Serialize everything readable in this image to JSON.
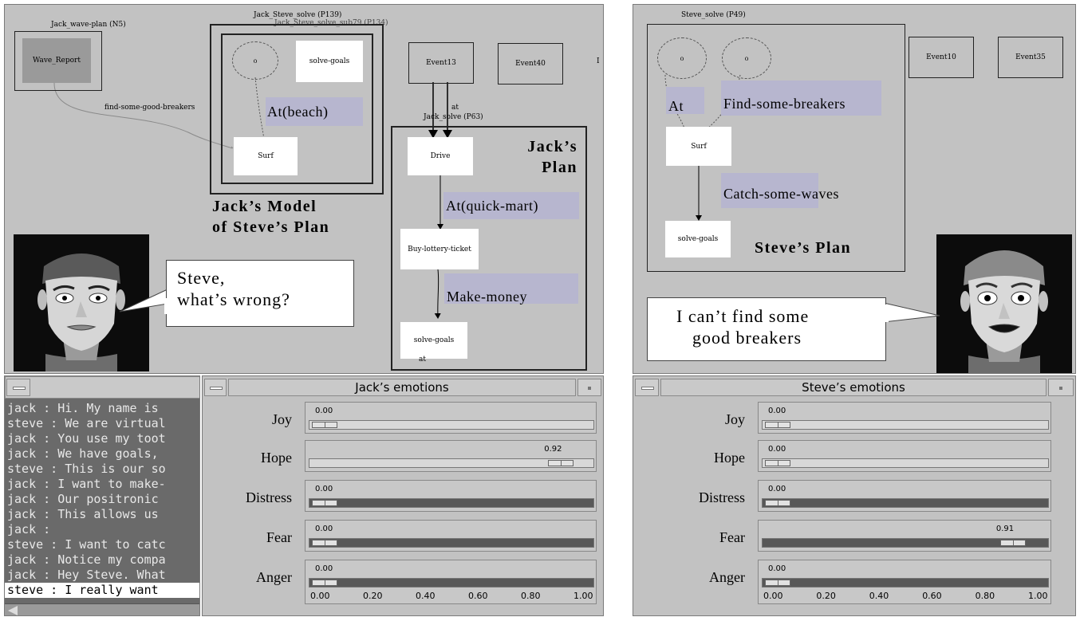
{
  "left": {
    "plan": {
      "graph_title": "Jack_wave-plan (N5)",
      "wave_report": "Wave_Report",
      "edge_label": "find-some-good-breakers",
      "solve_title": "Jack_Steve_solve (P139)",
      "solve_sub_title": "Jack_Steve_solve_sub79 (P134)",
      "circle_o": "o",
      "solve_goals": "solve-goals",
      "at_beach": "At(beach)",
      "surf": "Surf",
      "model_caption_1": "Jack’s Model",
      "model_caption_2": "of Steve’s Plan",
      "event13": "Event13",
      "event40": "Event40",
      "edge_at": "at",
      "cut_char": "I",
      "jack_solve_title": "Jack_solve (P63)",
      "plan_caption_1": "Jack’s",
      "plan_caption_2": "Plan",
      "drive": "Drive",
      "at_quickmart": "At(quick-mart)",
      "buy_lottery": "Buy-lottery-ticket",
      "make_money": "Make-money",
      "solve_goals_2": "solve-goals",
      "at_small": "at",
      "speech_1": "Steve,",
      "speech_2": "what’s wrong?"
    },
    "chat_lines": [
      "jack : Hi. My name is",
      "steve : We are virtual",
      "jack : You use my toot",
      "jack : We have goals,",
      "steve : This is our so",
      "jack : I want to make-",
      "jack : Our positronic",
      "jack : This allows us",
      "jack :",
      "steve : I want to catc",
      "jack : Notice my compa",
      "jack : Hey Steve. What",
      "steve : I really want"
    ],
    "emotions": {
      "title": "Jack’s emotions",
      "rows": [
        {
          "label": "Joy",
          "value": 0.0,
          "value_text": "0.00",
          "filled": false
        },
        {
          "label": "Hope",
          "value": 0.92,
          "value_text": "0.92",
          "filled": false
        },
        {
          "label": "Distress",
          "value": 0.0,
          "value_text": "0.00",
          "filled": true
        },
        {
          "label": "Fear",
          "value": 0.0,
          "value_text": "0.00",
          "filled": true
        },
        {
          "label": "Anger",
          "value": 0.0,
          "value_text": "0.00",
          "filled": true
        }
      ],
      "ticks": [
        "0.00",
        "0.20",
        "0.40",
        "0.60",
        "0.80",
        "1.00"
      ]
    }
  },
  "right": {
    "plan": {
      "title": "Steve_solve (P49)",
      "circle_o1": "o",
      "circle_o2": "o",
      "at": "At",
      "find_breakers": "Find-some-breakers",
      "surf": "Surf",
      "catch_waves": "Catch-some-waves",
      "solve_goals": "solve-goals",
      "caption": "Steve’s Plan",
      "event10": "Event10",
      "event35": "Event35",
      "speech_1": "I can’t find some",
      "speech_2": "good breakers"
    },
    "emotions": {
      "title": "Steve’s emotions",
      "rows": [
        {
          "label": "Joy",
          "value": 0.0,
          "value_text": "0.00",
          "filled": false
        },
        {
          "label": "Hope",
          "value": 0.0,
          "value_text": "0.00",
          "filled": false
        },
        {
          "label": "Distress",
          "value": 0.0,
          "value_text": "0.00",
          "filled": true
        },
        {
          "label": "Fear",
          "value": 0.91,
          "value_text": "0.91",
          "filled": true
        },
        {
          "label": "Anger",
          "value": 0.0,
          "value_text": "0.00",
          "filled": true
        }
      ],
      "ticks": [
        "0.00",
        "0.20",
        "0.40",
        "0.60",
        "0.80",
        "1.00"
      ]
    }
  },
  "colors": {
    "panel_bg": "#c2c2c2",
    "highlight": "#b7b6cf",
    "trough_fill": "#585858",
    "chat_bg": "#6a6a6a",
    "chat_text": "#e8e8e8"
  }
}
